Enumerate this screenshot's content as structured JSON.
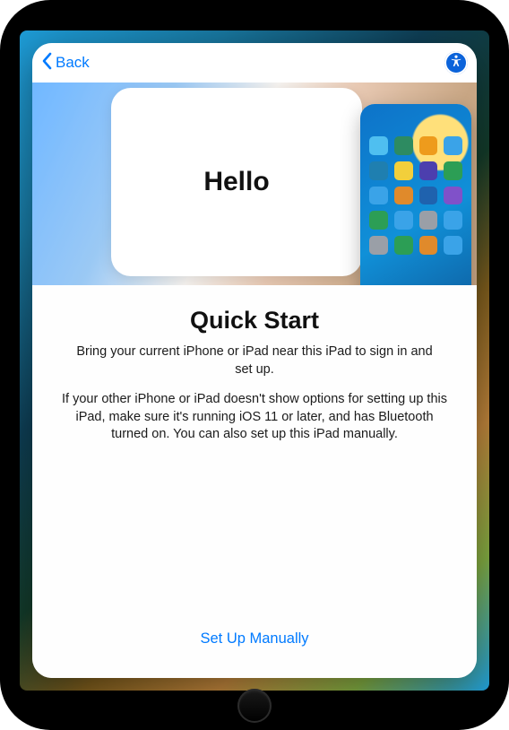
{
  "nav": {
    "back_label": "Back"
  },
  "hero": {
    "hello_text": "Hello"
  },
  "content": {
    "title": "Quick Start",
    "body1": "Bring your current iPhone or iPad near this iPad to sign in and set up.",
    "body2": "If your other iPhone or iPad doesn't show options for setting up this iPad, make sure it's running iOS 11 or later, and has Bluetooth turned on. You can also set up this iPad manually.",
    "manual_label": "Set Up Manually"
  },
  "app_grid_colors": [
    "#4fbff0",
    "#2d8b61",
    "#ee9b1c",
    "#3aa3e8",
    "#1f7fb0",
    "#f2cf3b",
    "#4c3fae",
    "#2c9e55",
    "#3aa3e8",
    "#e08a2b",
    "#1f62ae",
    "#8051c9",
    "#2c9e55",
    "#3aa3e8",
    "#9a9fa7",
    "#3aa3e8",
    "#9a9fa7",
    "#2c9e55",
    "#e08a2b",
    "#3aa3e8"
  ],
  "colors": {
    "ios_blue": "#007aff",
    "ax_blue": "#0b63da"
  }
}
